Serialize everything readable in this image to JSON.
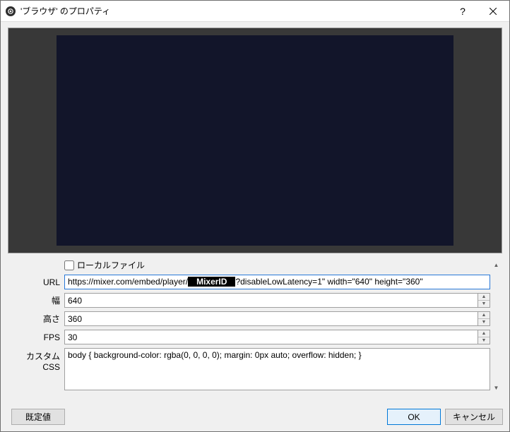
{
  "window": {
    "title": "'ブラウザ' のプロパティ"
  },
  "form": {
    "localFileLabel": "ローカルファイル",
    "localFileChecked": false,
    "urlLabel": "URL",
    "urlPrefix": "https://mixer.com/embed/player/",
    "urlRedacted": "MixerID",
    "urlSuffix": "?disableLowLatency=1\" width=\"640\" height=\"360\"",
    "widthLabel": "幅",
    "widthValue": "640",
    "heightLabel": "高さ",
    "heightValue": "360",
    "fpsLabel": "FPS",
    "fpsValue": "30",
    "cssLabel": "カスタム CSS",
    "cssValue": "body { background-color: rgba(0, 0, 0, 0); margin: 0px auto; overflow: hidden; }"
  },
  "buttons": {
    "defaults": "既定値",
    "ok": "OK",
    "cancel": "キャンセル"
  }
}
